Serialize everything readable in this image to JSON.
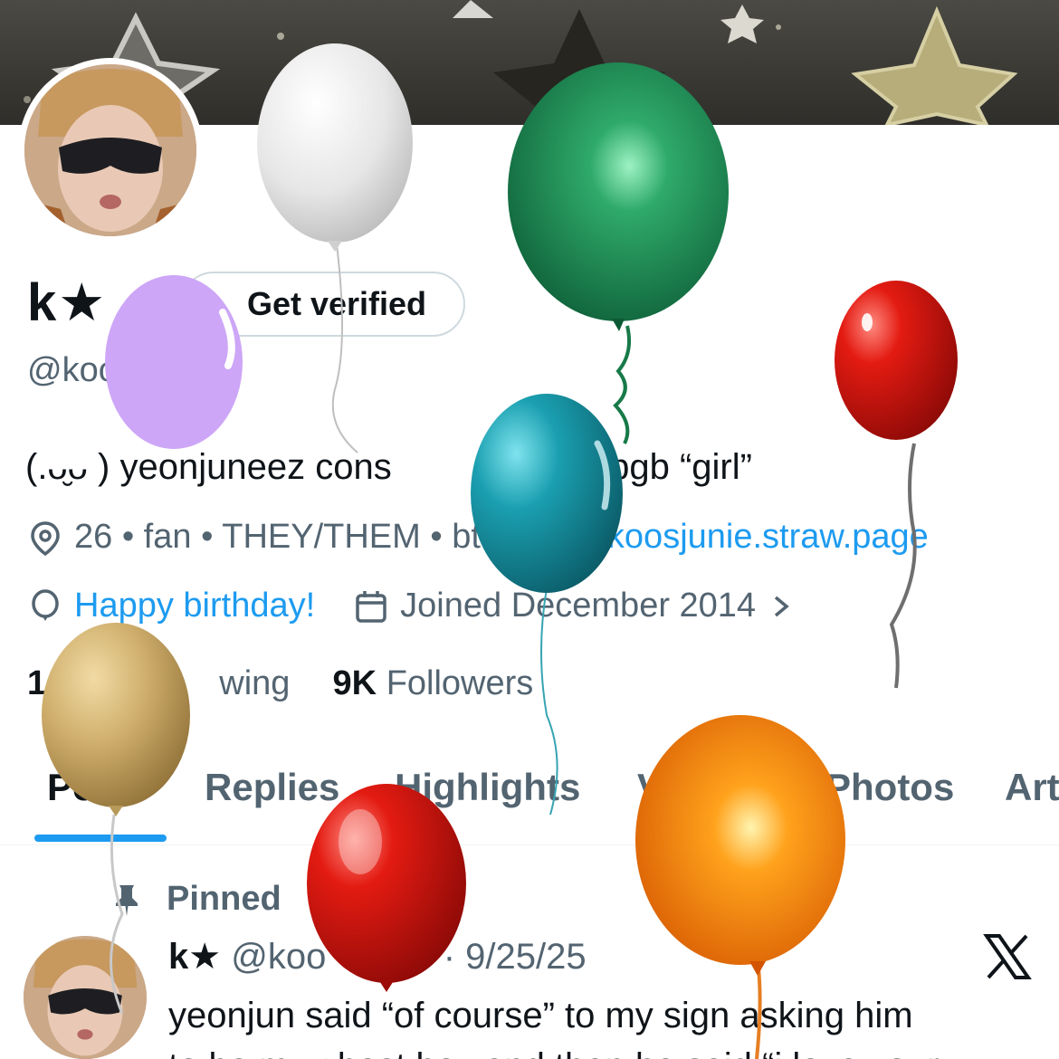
{
  "profile": {
    "display_name": "k★",
    "handle": "@koo",
    "get_verified_label": "Get verified",
    "bio": "(.ᴗ̮ᴗ ) yeonjuneez cons",
    "bio_tail": "yj’s gbgb “girl”",
    "meta": {
      "location_text": "26 • fan • THEY/THEM • bt",
      "website": "koosjunie.straw.page",
      "birthday": "Happy birthday!",
      "joined": "Joined December 2014"
    },
    "stats": {
      "following_count": "1",
      "following_label": "wing",
      "followers_count": "9K",
      "followers_label": "Followers"
    }
  },
  "tabs": [
    {
      "label": "Posts",
      "active": true
    },
    {
      "label": "Replies"
    },
    {
      "label": "Highlights"
    },
    {
      "label": "Videos"
    },
    {
      "label": "Photos"
    },
    {
      "label": "Art"
    }
  ],
  "pinned_post": {
    "pinned_label": "Pinned",
    "author_name": "k★",
    "author_handle": "@koo",
    "handle_tail": "e",
    "date": "· 9/25/25",
    "text_line1": "yeonjun said “of course” to my sign asking him",
    "text_line2": "to be my ghost boy and then he said “i love your"
  },
  "colors": {
    "accent": "#1d9bf0",
    "muted": "#536471",
    "text": "#0f1419"
  }
}
